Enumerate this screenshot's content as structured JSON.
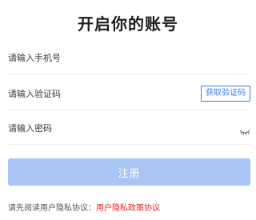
{
  "header": {
    "title": "开启你的账号"
  },
  "form": {
    "phone_placeholder": "请输入手机号",
    "code_placeholder": "请输入验证码",
    "get_code_label": "获取验证码",
    "password_placeholder": "请输入密码",
    "password_toggle_icon": "eye-closed-icon",
    "register_label": "注册"
  },
  "agreement": {
    "prompt": "请先阅读用户隐私协议：",
    "link_text": "用户隐私政策协议"
  },
  "colors": {
    "accent": "#3d7ee8",
    "register_disabled": "#a9c5f4",
    "link_red": "#e8242c"
  }
}
